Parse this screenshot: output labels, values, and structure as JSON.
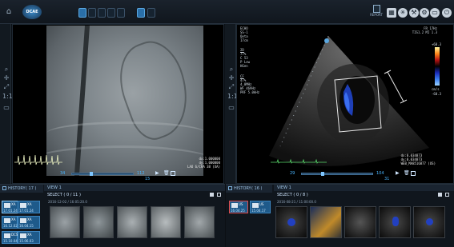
{
  "app": {
    "logo": "DCAE CS",
    "report_label": "REPORT"
  },
  "layout_buttons": [
    "1x1",
    "1x2",
    "2x2",
    "2x3",
    "3x3"
  ],
  "left_view": {
    "overlay_lines": [
      "dx:1.000000",
      "dy:1.000000",
      "LAO 6/CRA 38 (XA)"
    ],
    "frame": "34",
    "total": "112",
    "speed": "15"
  },
  "right_view": {
    "header_lines": [
      "ECHO",
      "SS-1",
      "Qeta",
      "17cm"
    ],
    "top_right": [
      "FR 17Hz",
      "TIS1.2 MI 1.3"
    ],
    "param_block1": [
      "2D",
      "77%",
      "C 53",
      "P Low",
      "HGen"
    ],
    "param_block2": [
      "CF",
      "47%",
      "4.0MHz",
      "WF 469Hz",
      "PRF 5.0kHz"
    ],
    "scale_top": "+60.3",
    "scale_label": "cm/s",
    "scale_bottom": "-60.3",
    "overlay_lines": [
      "dx:0.034873",
      "dy:0.034873",
      "WEB_MA8516877 (US)"
    ],
    "frame": "29",
    "total": "104",
    "speed": "31"
  },
  "history_left": {
    "title": "HISTORY",
    "count": "( 17 )",
    "view_label": "VIEW 1",
    "select_label": "SELECT ( 0 / 11 )",
    "series_date": "2016-12-02 / 16:05:20.0",
    "studies": [
      {
        "modality": "XA",
        "code": "A",
        "date": "17.01.24",
        "selected": true
      },
      {
        "modality": "XA",
        "code": "A",
        "date": "17.01.24",
        "selected": false
      },
      {
        "modality": "XA",
        "code": "A",
        "date": "16.12.02",
        "selected": false
      },
      {
        "modality": "XA",
        "code": "A",
        "date": "16.04.15",
        "selected": false
      },
      {
        "modality": "DCS",
        "code": "A",
        "date": "15.10.04",
        "selected": false
      },
      {
        "modality": "XA",
        "code": "A",
        "date": "15.06.03",
        "selected": false
      }
    ],
    "thumbs": [
      "1",
      "2",
      "3",
      "4",
      "5"
    ]
  },
  "history_right": {
    "title": "HISTORY",
    "count": "( 16 )",
    "view_label": "VIEW 1",
    "select_label": "SELECT ( 0 / 8 )",
    "series_date": "2016-08-21 / 11:00:00.0",
    "studies": [
      {
        "modality": "US",
        "code": "A",
        "date": "16.04.25",
        "selected": true
      },
      {
        "modality": "US",
        "code": "A",
        "date": "15.04.17",
        "selected": false
      }
    ],
    "thumbs": [
      "1",
      "2",
      "3",
      "4",
      "5"
    ]
  }
}
